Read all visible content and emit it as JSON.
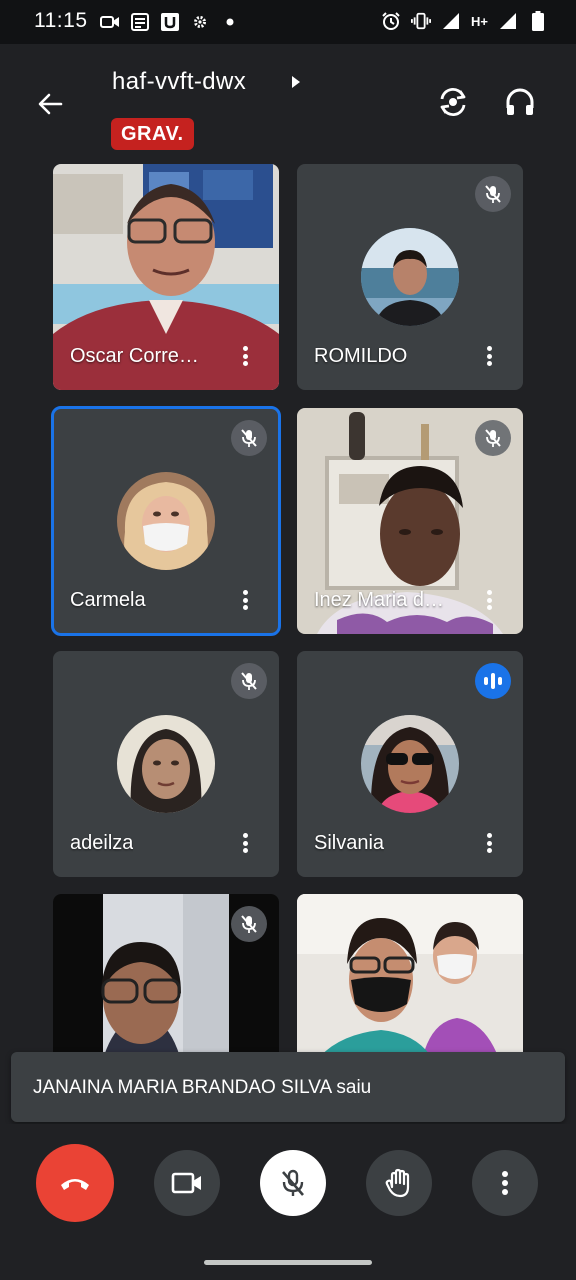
{
  "status_bar": {
    "time": "11:15",
    "left_icons": [
      "video-camera-icon",
      "news-icon",
      "u-app-icon",
      "settings-gear-icon",
      "notification-dot-icon"
    ],
    "network": "H+",
    "right_icons": [
      "alarm-icon",
      "vibrate-icon",
      "signal-icon",
      "signal-icon",
      "battery-icon"
    ]
  },
  "header": {
    "meeting_code": "haf-vvft-dwx",
    "recording_label": "GRAV.",
    "recording_color": "#c5221f",
    "icons": [
      "back-arrow-icon",
      "switch-camera-icon",
      "headphones-icon"
    ]
  },
  "participants": [
    {
      "name": "Oscar Corre…",
      "muted": false,
      "speaking": false,
      "view": "video"
    },
    {
      "name": "ROMILDO",
      "muted": true,
      "speaking": false,
      "view": "avatar"
    },
    {
      "name": "Carmela",
      "muted": true,
      "speaking": false,
      "view": "avatar",
      "highlighted": true
    },
    {
      "name": "Inez Maria d…",
      "muted": true,
      "speaking": false,
      "view": "video"
    },
    {
      "name": "adeilza",
      "muted": true,
      "speaking": false,
      "view": "avatar"
    },
    {
      "name": "Silvania",
      "muted": false,
      "speaking": true,
      "view": "avatar"
    },
    {
      "name": "",
      "muted": true,
      "speaking": false,
      "view": "video"
    },
    {
      "name": "",
      "muted": false,
      "speaking": false,
      "view": "video"
    }
  ],
  "toast": {
    "message": "JANAINA MARIA BRANDAO SILVA saiu"
  },
  "controls": {
    "buttons": [
      "end-call-icon",
      "camera-icon",
      "mic-off-icon",
      "raise-hand-icon",
      "more-options-icon"
    ],
    "end_call_color": "#ea4335",
    "active_speaker_color": "#1a73e8"
  }
}
